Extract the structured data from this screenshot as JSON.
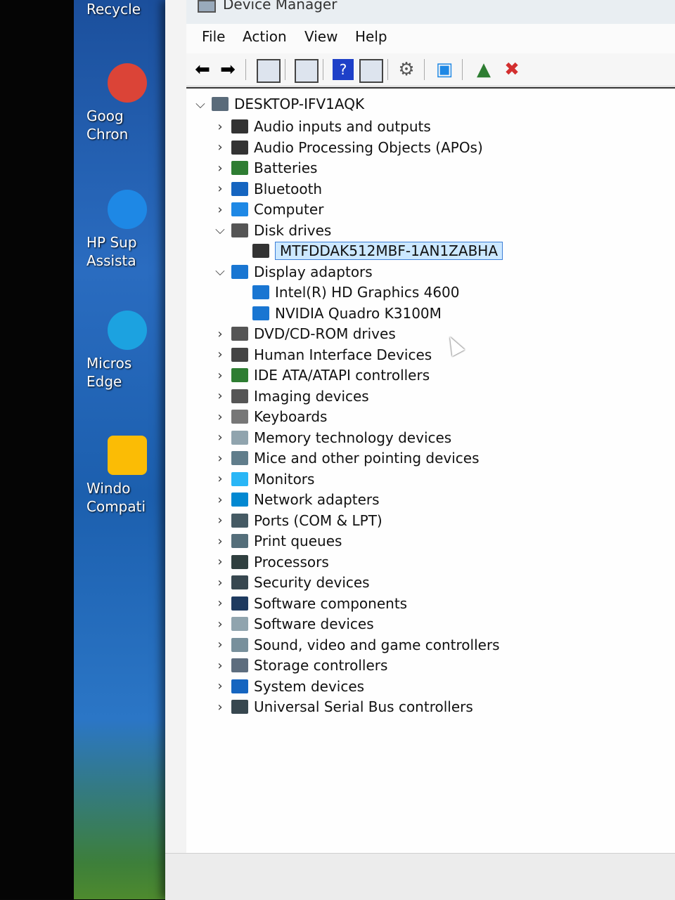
{
  "desktop": {
    "icons": [
      {
        "label": "Recycle",
        "color": "#cfd8e3"
      },
      {
        "label": "Goog Chron",
        "color": "#db4437"
      },
      {
        "label": "HP Sup Assista",
        "color": "#1e88e5"
      },
      {
        "label": "Micros Edge",
        "color": "#1ca2e0"
      },
      {
        "label": "Windo Compati",
        "color": "#fbbc05"
      }
    ]
  },
  "window": {
    "title": "Device Manager",
    "menu": [
      "File",
      "Action",
      "View",
      "Help"
    ],
    "toolbar": [
      "back-arrow",
      "forward-arrow",
      "properties",
      "update",
      "help",
      "view",
      "scan",
      "monitor",
      "enable",
      "uninstall"
    ]
  },
  "tree": {
    "root": "DESKTOP-IFV1AQK",
    "items": [
      {
        "label": "Audio inputs and outputs",
        "icon": "speaker-icon",
        "color": "#333333",
        "expanded": false
      },
      {
        "label": "Audio Processing Objects (APOs)",
        "icon": "speaker-icon",
        "color": "#333333",
        "expanded": false
      },
      {
        "label": "Batteries",
        "icon": "battery-icon",
        "color": "#2e7d32",
        "expanded": false
      },
      {
        "label": "Bluetooth",
        "icon": "bluetooth-icon",
        "color": "#1565c0",
        "expanded": false
      },
      {
        "label": "Computer",
        "icon": "computer-icon",
        "color": "#1e88e5",
        "expanded": false
      },
      {
        "label": "Disk drives",
        "icon": "disk-icon",
        "color": "#555555",
        "expanded": true,
        "children": [
          {
            "label": "MTFDDAK512MBF-1AN1ZABHA",
            "icon": "disk-icon",
            "color": "#333333",
            "selected": true
          }
        ]
      },
      {
        "label": "Display adaptors",
        "icon": "display-icon",
        "color": "#1976d2",
        "expanded": true,
        "children": [
          {
            "label": "Intel(R) HD Graphics 4600",
            "icon": "display-icon",
            "color": "#1976d2"
          },
          {
            "label": "NVIDIA Quadro K3100M",
            "icon": "display-icon",
            "color": "#1976d2"
          }
        ]
      },
      {
        "label": "DVD/CD-ROM drives",
        "icon": "dvd-icon",
        "color": "#555555",
        "expanded": false
      },
      {
        "label": "Human Interface Devices",
        "icon": "hid-icon",
        "color": "#444444",
        "expanded": false
      },
      {
        "label": "IDE ATA/ATAPI controllers",
        "icon": "ide-icon",
        "color": "#2e7d32",
        "expanded": false
      },
      {
        "label": "Imaging devices",
        "icon": "camera-icon",
        "color": "#555555",
        "expanded": false
      },
      {
        "label": "Keyboards",
        "icon": "keyboard-icon",
        "color": "#777777",
        "expanded": false
      },
      {
        "label": "Memory technology devices",
        "icon": "memory-icon",
        "color": "#90a4ae",
        "expanded": false
      },
      {
        "label": "Mice and other pointing devices",
        "icon": "mouse-icon",
        "color": "#607d8b",
        "expanded": false
      },
      {
        "label": "Monitors",
        "icon": "monitor-icon",
        "color": "#29b6f6",
        "expanded": false
      },
      {
        "label": "Network adapters",
        "icon": "network-icon",
        "color": "#0288d1",
        "expanded": false
      },
      {
        "label": "Ports (COM & LPT)",
        "icon": "port-icon",
        "color": "#455a64",
        "expanded": false
      },
      {
        "label": "Print queues",
        "icon": "printer-icon",
        "color": "#546e7a",
        "expanded": false
      },
      {
        "label": "Processors",
        "icon": "processor-icon",
        "color": "#2f3f3f",
        "expanded": false
      },
      {
        "label": "Security devices",
        "icon": "security-icon",
        "color": "#37474f",
        "expanded": false
      },
      {
        "label": "Software components",
        "icon": "software-component-icon",
        "color": "#1e3a5f",
        "expanded": false
      },
      {
        "label": "Software devices",
        "icon": "software-device-icon",
        "color": "#90a4ae",
        "expanded": false
      },
      {
        "label": "Sound, video and game controllers",
        "icon": "sound-icon",
        "color": "#78909c",
        "expanded": false
      },
      {
        "label": "Storage controllers",
        "icon": "storage-icon",
        "color": "#5d6d7e",
        "expanded": false
      },
      {
        "label": "System devices",
        "icon": "system-icon",
        "color": "#1565c0",
        "expanded": false
      },
      {
        "label": "Universal Serial Bus controllers",
        "icon": "usb-icon",
        "color": "#37474f",
        "expanded": false
      }
    ]
  },
  "colors": {
    "selection": "#cce8ff",
    "selection_border": "#3d7fd8"
  }
}
